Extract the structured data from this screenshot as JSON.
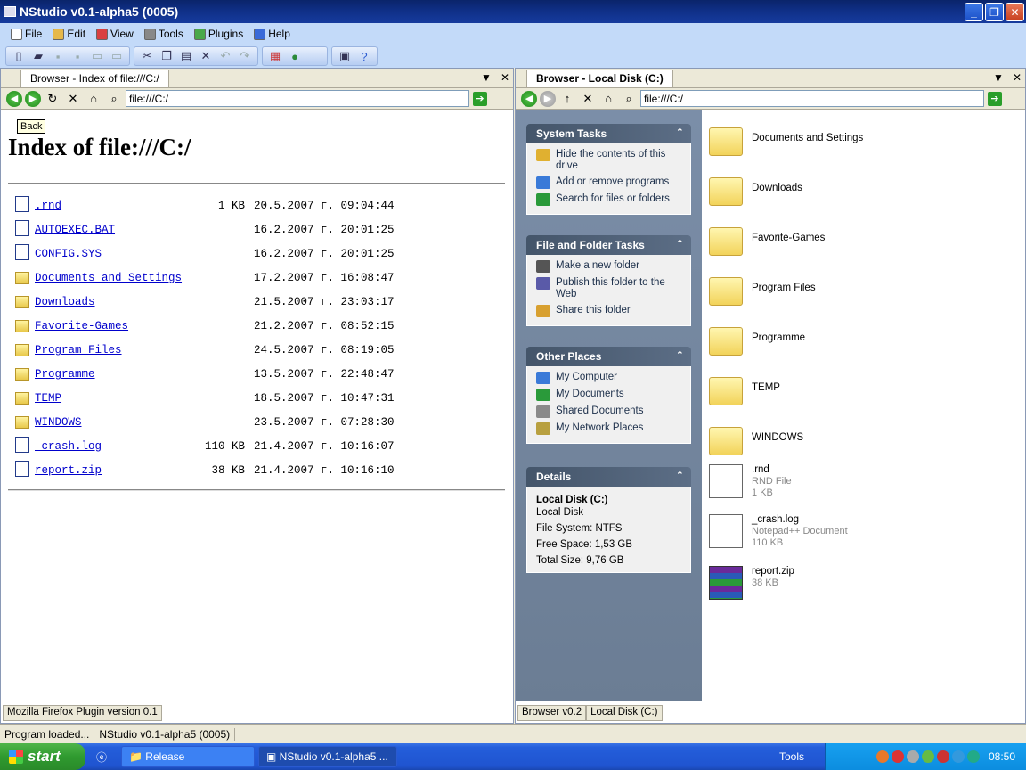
{
  "window": {
    "title": "NStudio v0.1-alpha5 (0005)",
    "controls": {
      "minimize": "_",
      "maximize": "❐",
      "close": "✕"
    }
  },
  "menu": [
    {
      "label": "File",
      "icon": "file-icon",
      "color": "#ffffff"
    },
    {
      "label": "Edit",
      "icon": "edit-icon",
      "color": "#e6b84a"
    },
    {
      "label": "View",
      "icon": "view-icon",
      "color": "#d94040"
    },
    {
      "label": "Tools",
      "icon": "tools-icon",
      "color": "#888888"
    },
    {
      "label": "Plugins",
      "icon": "plugins-icon",
      "color": "#4aa84a"
    },
    {
      "label": "Help",
      "icon": "help-icon",
      "color": "#3a6ad8"
    }
  ],
  "left_pane": {
    "tab_label": "Browser - Index of file:///C:/",
    "address": "file:///C:/",
    "tooltip": "Back",
    "page_title": "Index of file:///C:/",
    "files": [
      {
        "name": ".rnd",
        "type": "file",
        "size": "1 KB",
        "date": "20.5.2007 г. 09:04:44"
      },
      {
        "name": "AUTOEXEC.BAT",
        "type": "file",
        "size": "",
        "date": "16.2.2007 г. 20:01:25"
      },
      {
        "name": "CONFIG.SYS",
        "type": "file",
        "size": "",
        "date": "16.2.2007 г. 20:01:25"
      },
      {
        "name": "Documents and Settings",
        "type": "folder",
        "size": "",
        "date": "17.2.2007 г. 16:08:47"
      },
      {
        "name": "Downloads",
        "type": "folder",
        "size": "",
        "date": "21.5.2007 г. 23:03:17"
      },
      {
        "name": "Favorite-Games",
        "type": "folder",
        "size": "",
        "date": "21.2.2007 г. 08:52:15"
      },
      {
        "name": "Program Files",
        "type": "folder",
        "size": "",
        "date": "24.5.2007 г. 08:19:05"
      },
      {
        "name": "Programme",
        "type": "folder",
        "size": "",
        "date": "13.5.2007 г. 22:48:47"
      },
      {
        "name": "TEMP",
        "type": "folder",
        "size": "",
        "date": "18.5.2007 г. 10:47:31"
      },
      {
        "name": "WINDOWS",
        "type": "folder",
        "size": "",
        "date": "23.5.2007 г. 07:28:30"
      },
      {
        "name": "_crash.log",
        "type": "file",
        "size": "110 KB",
        "date": "21.4.2007 г. 10:16:07"
      },
      {
        "name": "report.zip",
        "type": "file",
        "size": "38 KB",
        "date": "21.4.2007 г. 10:16:10"
      }
    ],
    "status": "Mozilla Firefox Plugin version 0.1"
  },
  "right_pane": {
    "tab_label": "Browser - Local Disk (C:)",
    "address": "file:///C:/",
    "system_tasks": {
      "title": "System Tasks",
      "items": [
        "Hide the contents of this drive",
        "Add or remove programs",
        "Search for files or folders"
      ]
    },
    "file_tasks": {
      "title": "File and Folder Tasks",
      "items": [
        "Make a new folder",
        "Publish this folder to the Web",
        "Share this folder"
      ]
    },
    "other_places": {
      "title": "Other Places",
      "items": [
        "My Computer",
        "My Documents",
        "Shared Documents",
        "My Network Places"
      ]
    },
    "details": {
      "title": "Details",
      "name": "Local Disk (C:)",
      "kind": "Local Disk",
      "fs": "File System: NTFS",
      "free": "Free Space: 1,53 GB",
      "total": "Total Size: 9,76 GB"
    },
    "items": [
      {
        "name": "Documents and Settings",
        "type": "folder"
      },
      {
        "name": "Downloads",
        "type": "folder"
      },
      {
        "name": "Favorite-Games",
        "type": "folder"
      },
      {
        "name": "Program Files",
        "type": "folder"
      },
      {
        "name": "Programme",
        "type": "folder"
      },
      {
        "name": "TEMP",
        "type": "folder"
      },
      {
        "name": "WINDOWS",
        "type": "folder"
      },
      {
        "name": ".rnd",
        "type": "doc",
        "kind": "RND File",
        "size": "1 KB"
      },
      {
        "name": "_crash.log",
        "type": "doc",
        "kind": "Notepad++ Document",
        "size": "110 KB"
      },
      {
        "name": "report.zip",
        "type": "zip",
        "kind": "",
        "size": "38 KB"
      }
    ],
    "status": [
      "Browser v0.2",
      "Local Disk (C:)"
    ]
  },
  "statusbar": [
    "Program loaded...",
    "NStudio v0.1-alpha5 (0005)"
  ],
  "taskbar": {
    "start": "start",
    "tasks": [
      "Release",
      "NStudio v0.1-alpha5 ..."
    ],
    "tools": "Tools",
    "clock": "08:50"
  }
}
